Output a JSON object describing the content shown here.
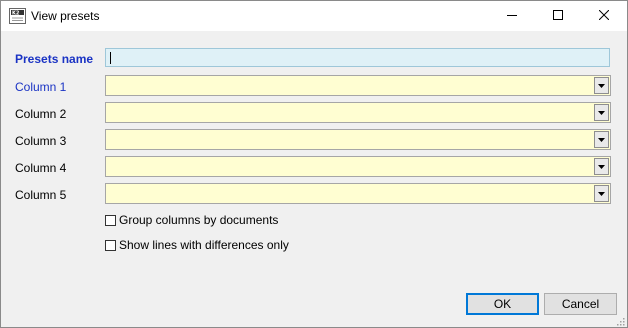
{
  "window": {
    "title": "View presets"
  },
  "form": {
    "presets_name_label": "Presets name",
    "presets_name_value": "",
    "columns": [
      {
        "label": "Column 1",
        "value": ""
      },
      {
        "label": "Column 2",
        "value": ""
      },
      {
        "label": "Column 3",
        "value": ""
      },
      {
        "label": "Column 4",
        "value": ""
      },
      {
        "label": "Column 5",
        "value": ""
      }
    ],
    "group_by_documents_label": "Group columns by documents",
    "group_by_documents_checked": false,
    "differences_only_label": "Show lines with differences only",
    "differences_only_checked": false
  },
  "buttons": {
    "ok_label": "OK",
    "cancel_label": "Cancel"
  },
  "colors": {
    "label_accent": "#1a33c4",
    "name_input_bg": "#dff1f7",
    "combo_bg": "#fffed2",
    "default_button_border": "#0078d7"
  }
}
